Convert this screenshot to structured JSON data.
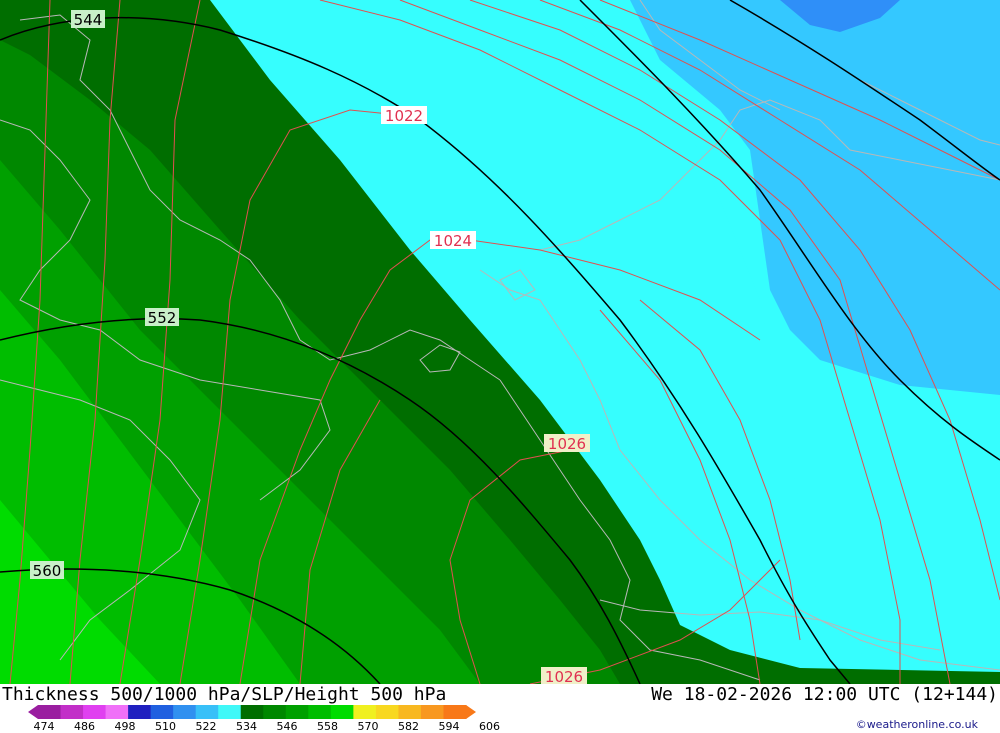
{
  "footer": {
    "title": "Thickness 500/1000 hPa/SLP/Height 500 hPa",
    "valid_time": "We 18-02-2026 12:00 UTC (12+144)",
    "credit": "©weatheronline.co.uk"
  },
  "legend": {
    "ticks": [
      "474",
      "486",
      "498",
      "510",
      "522",
      "534",
      "546",
      "558",
      "570",
      "582",
      "594",
      "606"
    ],
    "colors": [
      "#9a1ea0",
      "#c22fc8",
      "#e040f0",
      "#f070f8",
      "#2020c0",
      "#2060e0",
      "#3090f0",
      "#38c0f8",
      "#40f8f8",
      "#006e00",
      "#008800",
      "#00a000",
      "#00bd00",
      "#00dc00",
      "#f0f020",
      "#f8d820",
      "#f8b820",
      "#f89820",
      "#f87818"
    ]
  },
  "contours": {
    "height_labels": [
      "544",
      "552",
      "560"
    ],
    "pressure_labels": [
      "1022",
      "1024",
      "1026",
      "1026"
    ]
  }
}
